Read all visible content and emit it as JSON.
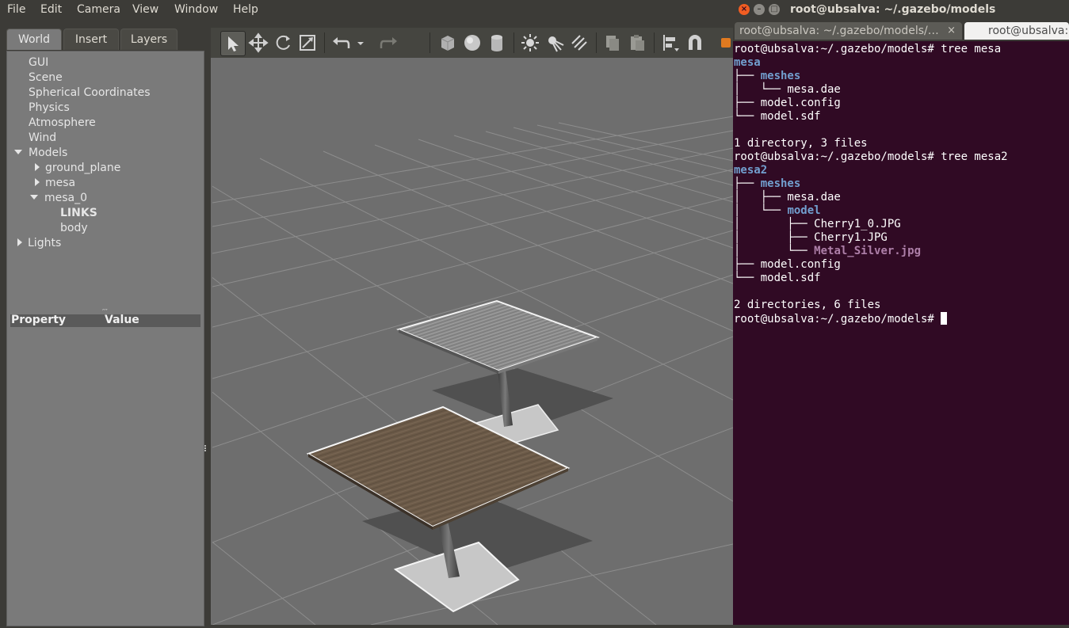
{
  "menubar": {
    "items": [
      "File",
      "Edit",
      "Camera",
      "View",
      "Window",
      "Help"
    ]
  },
  "left_panel": {
    "tabs": [
      "World",
      "Insert",
      "Layers"
    ],
    "active_tab": "World",
    "tree": {
      "gui": "GUI",
      "scene": "Scene",
      "spherical": "Spherical Coordinates",
      "physics": "Physics",
      "atmosphere": "Atmosphere",
      "wind": "Wind",
      "models": "Models",
      "ground_plane": "ground_plane",
      "mesa": "mesa",
      "mesa_0": "mesa_0",
      "links": "LINKS",
      "body": "body",
      "lights": "Lights"
    },
    "property_header": {
      "property": "Property",
      "value": "Value"
    },
    "grip": "′′′"
  },
  "toolbar": {
    "icons": [
      "select-icon",
      "translate-icon",
      "rotate-icon",
      "scale-icon",
      "undo-icon",
      "undo-dropdown-icon",
      "redo-icon",
      "box-icon",
      "sphere-icon",
      "cylinder-icon",
      "point-light-icon",
      "spot-light-icon",
      "directional-light-icon",
      "copy-icon",
      "paste-icon",
      "align-icon",
      "snap-icon"
    ]
  },
  "terminal": {
    "title": "root@ubsalva: ~/.gazebo/models",
    "tab1": "root@ubsalva: ~/.gazebo/models/…",
    "tab1_close": "×",
    "tab2": "root@ubsalva: ~",
    "lines": {
      "l1": "root@ubsalva:~/.gazebo/models# tree mesa",
      "l2": "mesa",
      "l3_pre": "├── ",
      "l3_dir": "meshes",
      "l4": "│   └── mesa.dae",
      "l5": "├── model.config",
      "l6": "└── model.sdf",
      "l7": "",
      "l8": "1 directory, 3 files",
      "l9": "root@ubsalva:~/.gazebo/models# tree mesa2",
      "l10": "mesa2",
      "l11_pre": "├── ",
      "l11_dir": "meshes",
      "l12": "│   ├── mesa.dae",
      "l13_pre": "│   └── ",
      "l13_dir": "model",
      "l14": "│       ├── Cherry1_0.JPG",
      "l15": "│       ├── Cherry1.JPG",
      "l16_pre": "│       └── ",
      "l16_img": "Metal_Silver.jpg",
      "l17": "├── model.config",
      "l18": "└── model.sdf",
      "l19": "",
      "l20": "2 directories, 6 files",
      "l21": "root@ubsalva:~/.gazebo/models# "
    }
  },
  "colors": {
    "terminal_bg": "#300a24",
    "dir": "#729fcf",
    "image_file": "#ad7fa8",
    "close_btn": "#f15d22"
  }
}
